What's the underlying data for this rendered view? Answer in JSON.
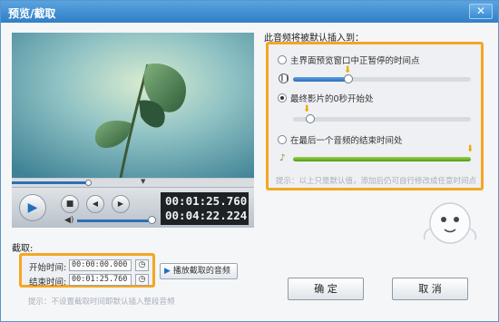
{
  "window": {
    "title": "预览/截取",
    "close_glyph": "✕"
  },
  "player": {
    "scene": "video frame: leaf plant against blurred teal background",
    "progress_fraction": 0.32,
    "volume_fraction": 0.95,
    "current_time": "00:01:25.760",
    "total_time": "00:04:22.224",
    "icons": {
      "play": "play-icon",
      "stop": "stop-icon",
      "prev": "prev-icon",
      "next": "next-icon",
      "volume": "volume-icon"
    }
  },
  "clip": {
    "label": "截取:",
    "start_label": "开始时间:",
    "start_value": "00:00:00.000",
    "end_label": "结束时间:",
    "end_value": "00:01:25.760",
    "play_button": "播放截取的音频",
    "hint": "提示：不设置截取时间即默认插入整段音频"
  },
  "insert": {
    "label": "此音频将被默认插入到：",
    "options": [
      {
        "label": "主界面预览窗口中正暂停的时间点",
        "selected": false,
        "position_fraction": 0.31
      },
      {
        "label": "最终影片的0秒开始处",
        "selected": true,
        "position_fraction": 0.0
      },
      {
        "label": "在最后一个音频的结束时间处",
        "selected": false,
        "position_fraction": 1.0
      }
    ],
    "hint": "提示：以上只是默认值，添加后仍可自行修改成任意时间点"
  },
  "buttons": {
    "ok": "确 定",
    "cancel": "取 消"
  },
  "colors": {
    "accent": "#f5a623",
    "title_bar": "#3b8ad0",
    "time_bg": "#1e2226",
    "green_track": "#5b9e1f"
  }
}
